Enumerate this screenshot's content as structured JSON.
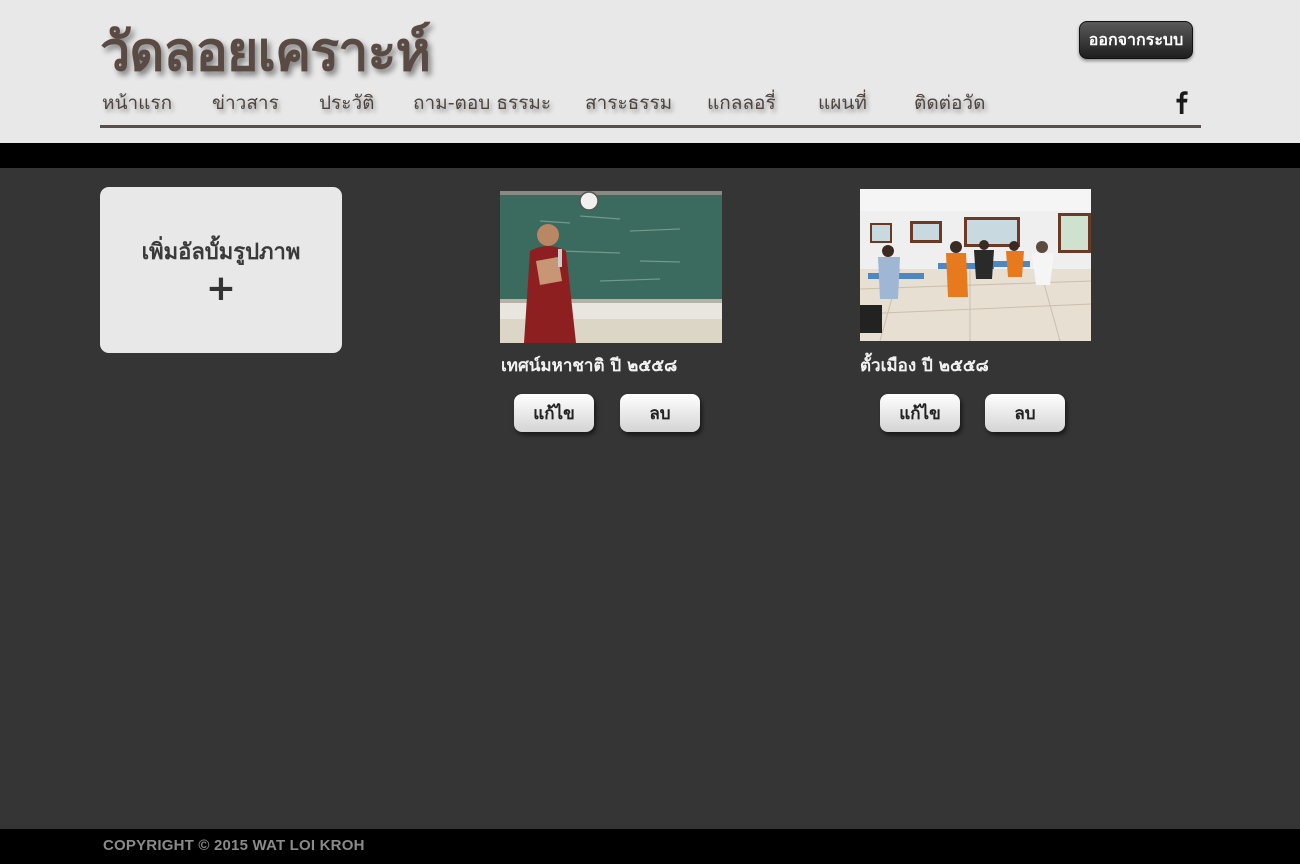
{
  "header": {
    "site_title": "วัดลอยเคราะห์",
    "logout_label": "ออกจากระบบ",
    "facebook_icon": "facebook-icon"
  },
  "nav": {
    "items": [
      {
        "label": "หน้าแรก"
      },
      {
        "label": "ข่าวสาร"
      },
      {
        "label": "ประวัติ"
      },
      {
        "label": "ถาม-ตอบ ธรรมะ"
      },
      {
        "label": "สาระธรรม"
      },
      {
        "label": "แกลลอรี่"
      },
      {
        "label": "แผนที่"
      },
      {
        "label": "ติดต่อวัด"
      }
    ]
  },
  "add_album": {
    "label": "เพิ่มอัลบั้มรูปภาพ",
    "plus": "+"
  },
  "albums": [
    {
      "title": "เทศน์มหาชาติ ปี ๒๕๕๘",
      "edit_label": "แก้ไข",
      "delete_label": "ลบ"
    },
    {
      "title": "ตั้วเมือง ปี ๒๕๕๘",
      "edit_label": "แก้ไข",
      "delete_label": "ลบ"
    }
  ],
  "footer": {
    "copyright": "COPYRIGHT © 2015 WAT LOI KROH"
  },
  "colors": {
    "header_bg": "#e8e8e8",
    "page_bg": "#353535",
    "title_brown": "#5a4a44",
    "band": "#000000"
  }
}
